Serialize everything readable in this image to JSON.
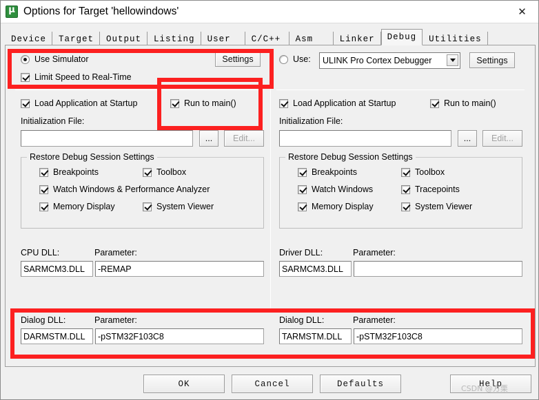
{
  "window": {
    "title": "Options for Target 'hellowindows'",
    "icon": "keil-uvision-icon",
    "close_label": "✕"
  },
  "tabs": [
    {
      "label": "Device",
      "active": false
    },
    {
      "label": "Target",
      "active": false
    },
    {
      "label": "Output",
      "active": false
    },
    {
      "label": "Listing",
      "active": false
    },
    {
      "label": "User",
      "active": false
    },
    {
      "label": "C/C++",
      "active": false
    },
    {
      "label": "Asm",
      "active": false
    },
    {
      "label": "Linker",
      "active": false
    },
    {
      "label": "Debug",
      "active": true
    },
    {
      "label": "Utilities",
      "active": false
    }
  ],
  "left": {
    "use_simulator_label": "Use Simulator",
    "use_simulator_checked": true,
    "settings_label": "Settings",
    "limit_speed_label": "Limit Speed to Real-Time",
    "limit_speed_checked": true,
    "load_app_label": "Load Application at Startup",
    "load_app_checked": true,
    "run_to_main_label": "Run to main()",
    "run_to_main_checked": true,
    "init_file_label": "Initialization File:",
    "init_file_value": "",
    "browse_label": "...",
    "edit_label": "Edit...",
    "restore_group_label": "Restore Debug Session Settings",
    "restore_items": [
      {
        "label": "Breakpoints",
        "checked": true
      },
      {
        "label": "Toolbox",
        "checked": true
      },
      {
        "label": "Watch Windows & Performance Analyzer",
        "checked": true
      },
      {
        "label": "Memory Display",
        "checked": true
      },
      {
        "label": "System Viewer",
        "checked": true
      }
    ],
    "cpu_dll_label": "CPU DLL:",
    "cpu_dll_value": "SARMCM3.DLL",
    "cpu_param_label": "Parameter:",
    "cpu_param_value": "-REMAP",
    "dialog_dll_label": "Dialog DLL:",
    "dialog_dll_value": "DARMSTM.DLL",
    "dialog_param_label": "Parameter:",
    "dialog_param_value": "-pSTM32F103C8"
  },
  "right": {
    "use_label": "Use:",
    "use_checked": false,
    "debugger_selected": "ULINK Pro Cortex Debugger",
    "settings_label": "Settings",
    "load_app_label": "Load Application at Startup",
    "load_app_checked": true,
    "run_to_main_label": "Run to main()",
    "run_to_main_checked": true,
    "init_file_label": "Initialization File:",
    "init_file_value": "",
    "browse_label": "...",
    "edit_label": "Edit...",
    "restore_group_label": "Restore Debug Session Settings",
    "restore_items": [
      {
        "label": "Breakpoints",
        "checked": true
      },
      {
        "label": "Toolbox",
        "checked": true
      },
      {
        "label": "Watch Windows",
        "checked": true
      },
      {
        "label": "Tracepoints",
        "checked": true
      },
      {
        "label": "Memory Display",
        "checked": true
      },
      {
        "label": "System Viewer",
        "checked": true
      }
    ],
    "driver_dll_label": "Driver DLL:",
    "driver_dll_value": "SARMCM3.DLL",
    "driver_param_label": "Parameter:",
    "driver_param_value": "",
    "dialog_dll_label": "Dialog DLL:",
    "dialog_dll_value": "TARMSTM.DLL",
    "dialog_param_label": "Parameter:",
    "dialog_param_value": "-pSTM32F103C8"
  },
  "footer": {
    "ok_label": "OK",
    "cancel_label": "Cancel",
    "defaults_label": "Defaults",
    "help_label": "Help"
  },
  "watermark": {
    "text": "CSDN @方栗"
  },
  "annotations": {
    "highlight_color": "#fc2020",
    "boxes": [
      {
        "name": "simulator-highlight"
      },
      {
        "name": "run-to-main-highlight"
      },
      {
        "name": "dialog-dll-highlight"
      }
    ]
  }
}
